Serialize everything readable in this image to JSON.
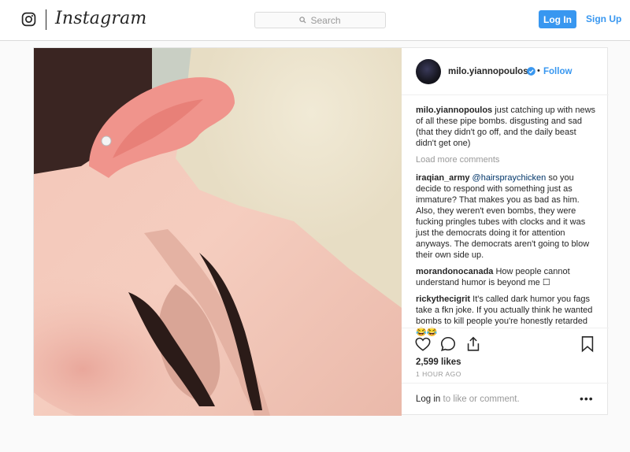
{
  "header": {
    "brand": "Instagram",
    "search_placeholder": "Search",
    "login_label": "Log In",
    "signup_label": "Sign Up"
  },
  "post": {
    "username": "milo.yiannopoulos",
    "follow_label": "Follow",
    "caption": {
      "username": "milo.yiannopoulos",
      "text": "just catching up with news of all these pipe bombs. disgusting and sad (that they didn't go off, and the daily beast didn't get one)"
    },
    "load_more_label": "Load more comments",
    "comments": [
      {
        "username": "iraqian_army",
        "mention": "@hairspraychicken",
        "text": "so you decide to respond with something just as immature? That makes you as bad as him. Also, they weren't even bombs, they were fucking pringles tubes with clocks and it was just the democrats doing it for attention anyways. The democrats aren't going to blow their own side up."
      },
      {
        "username": "morandonocanada",
        "mention": "",
        "text": "How people cannot understand humor is beyond me ☐"
      },
      {
        "username": "rickythecigrit",
        "mention": "",
        "text": "It's called dark humor you fags take a fkn joke. If you actually think he wanted bombs to kill people you're honestly retarded 😂😂"
      }
    ],
    "likes": "2,599 likes",
    "time_ago": "1 HOUR AGO",
    "login_link": "Log in",
    "login_suffix": "to like or comment.",
    "more_options": "•••"
  },
  "colors": {
    "accent": "#3897f0",
    "text": "#262626",
    "muted": "#999999",
    "border": "#dbdbdb"
  },
  "icons": [
    "instagram-glyph-icon",
    "search-icon",
    "verified-badge-icon",
    "heart-icon",
    "comment-icon",
    "share-icon",
    "bookmark-icon",
    "more-icon"
  ]
}
